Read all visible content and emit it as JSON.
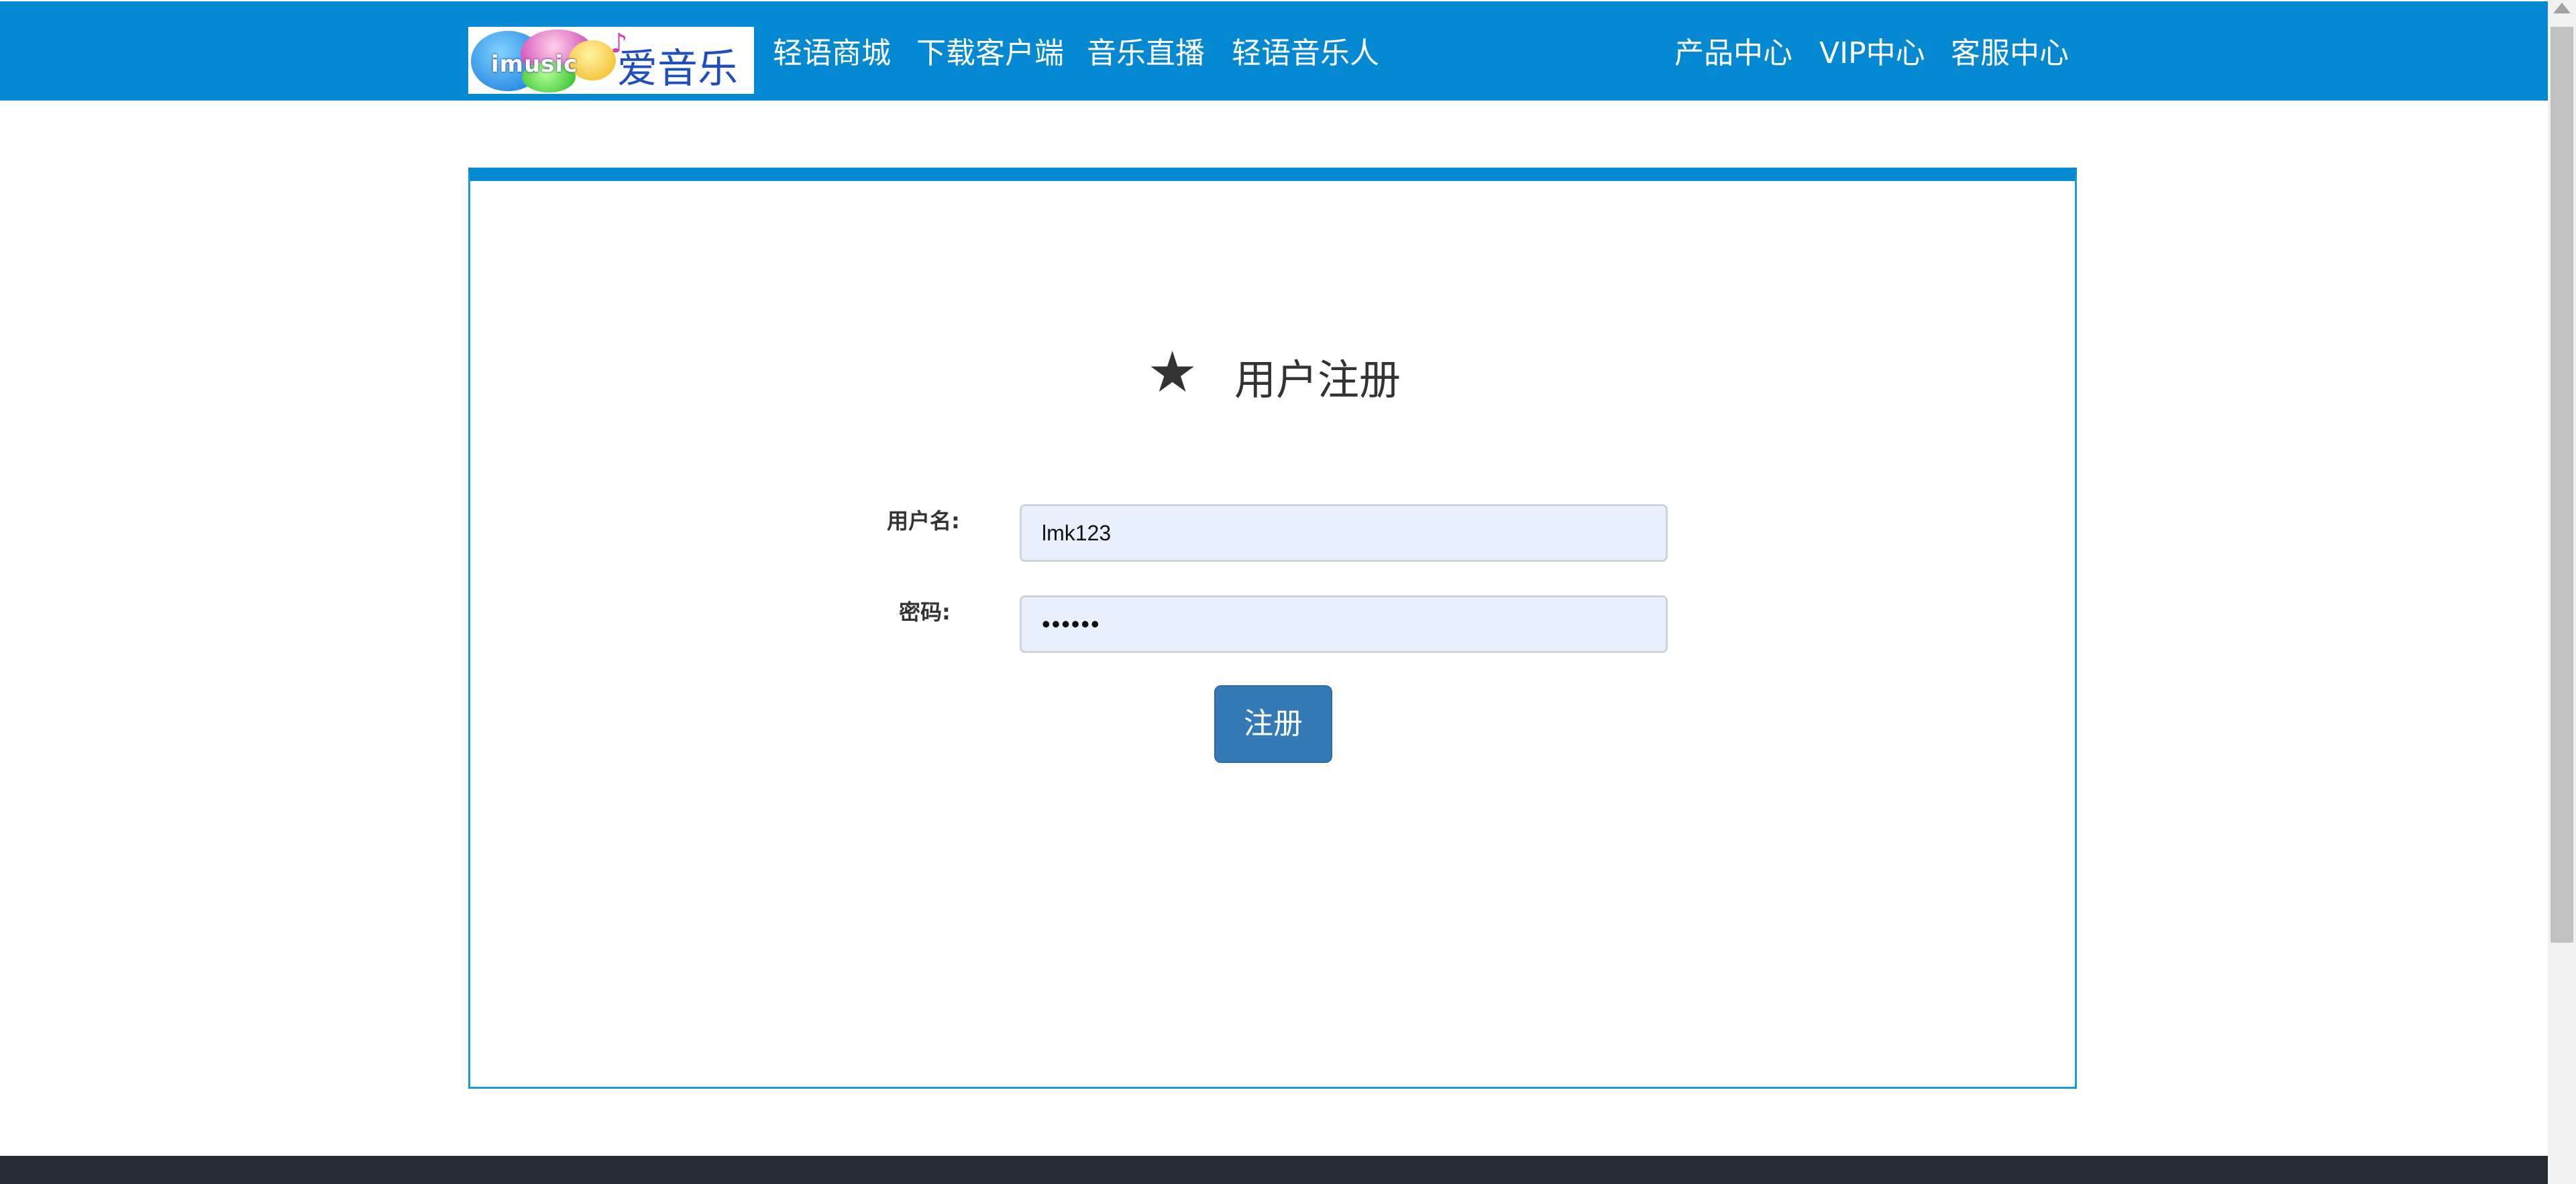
{
  "header": {
    "logo": {
      "mark": "imusic",
      "name": "爱音乐",
      "note": "♪"
    },
    "nav_left": [
      "轻语商城",
      "下载客户端",
      "音乐直播",
      "轻语音乐人"
    ],
    "nav_right": [
      "产品中心",
      "VIP中心",
      "客服中心"
    ]
  },
  "form": {
    "star_icon": "★",
    "title": "用户注册",
    "username_label": "用户名:",
    "username_value": "lmk123",
    "password_label": "密码:",
    "password_value": "••••••",
    "submit_label": "注册"
  },
  "colors": {
    "accent": "#0388d1",
    "button": "#337ab7",
    "input_bg": "#e8f0fe",
    "footer": "#272c34"
  }
}
